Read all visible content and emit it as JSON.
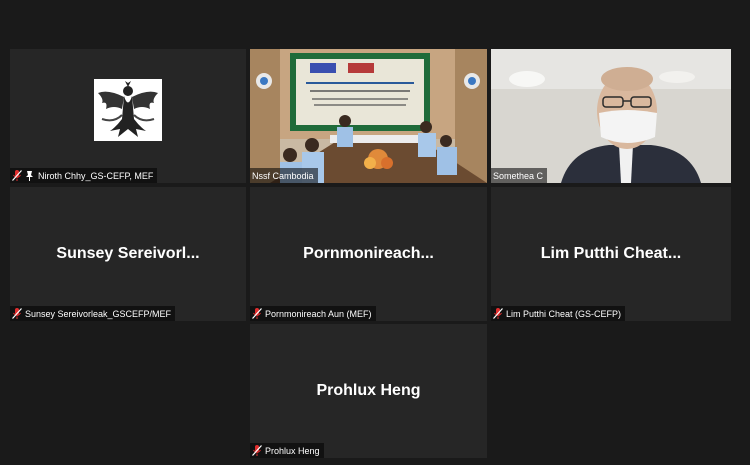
{
  "participants": [
    {
      "display_name": "Niroth Chhy_GS-CEFP, MEF",
      "muted": true,
      "pinned": true
    },
    {
      "display_name": "Nssf Cambodia",
      "muted": false
    },
    {
      "display_name": "Somethea C",
      "muted": false,
      "active_speaker": true
    },
    {
      "center_label": "Sunsey  Sereivorl...",
      "display_name": "Sunsey Sereivorleak_GSCEFP/MEF",
      "muted": true
    },
    {
      "center_label": "Pornmonireach...",
      "display_name": "Pornmonireach Aun (MEF)",
      "muted": true
    },
    {
      "center_label": "Lim Putthi Cheat...",
      "display_name": "Lim Putthi Cheat (GS-CEFP)",
      "muted": true
    },
    {
      "center_label": "Prohlux Heng",
      "display_name": "Prohlux Heng",
      "muted": true
    }
  ],
  "colors": {
    "background": "#1a1a1a",
    "tile": "#262626",
    "active_speaker_border": "#cfe23b",
    "muted_mic": "#e02d2d"
  },
  "icons": {
    "muted": "mic-muted-icon",
    "pinned": "pin-icon",
    "logo": "emblem-logo-icon"
  }
}
